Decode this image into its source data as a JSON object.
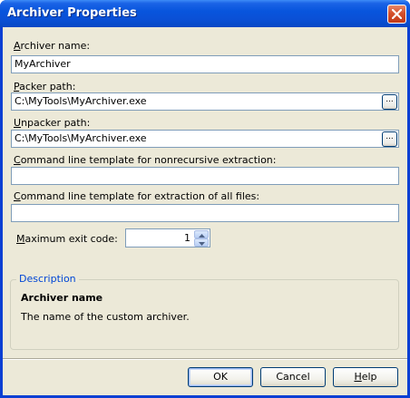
{
  "window": {
    "title": "Archiver Properties",
    "close_icon": "close-icon"
  },
  "form": {
    "archiver_name": {
      "label_prefix": "A",
      "label_rest": "rchiver name:",
      "value": "MyArchiver"
    },
    "packer_path": {
      "label_prefix": "P",
      "label_rest": "acker path:",
      "value": "C:\\MyTools\\MyArchiver.exe",
      "browse_label": "..."
    },
    "unpacker_path": {
      "label_prefix": "U",
      "label_rest": "npacker path:",
      "value": "C:\\MyTools\\MyArchiver.exe",
      "browse_label": "..."
    },
    "nonrecursive_template": {
      "label_prefix": "C",
      "label_rest": "ommand line template for nonrecursive extraction:",
      "value": ""
    },
    "all_files_template": {
      "label_prefix": "C",
      "label_rest": "ommand line template for extraction of all files:",
      "value": ""
    },
    "max_exit_code": {
      "label_prefix": "M",
      "label_rest": "aximum exit code:",
      "value": "1"
    }
  },
  "description": {
    "legend": "Description",
    "title": "Archiver name",
    "text": "The name of the custom archiver."
  },
  "buttons": {
    "ok": "OK",
    "cancel": "Cancel",
    "help_prefix": "H",
    "help_rest": "elp"
  }
}
